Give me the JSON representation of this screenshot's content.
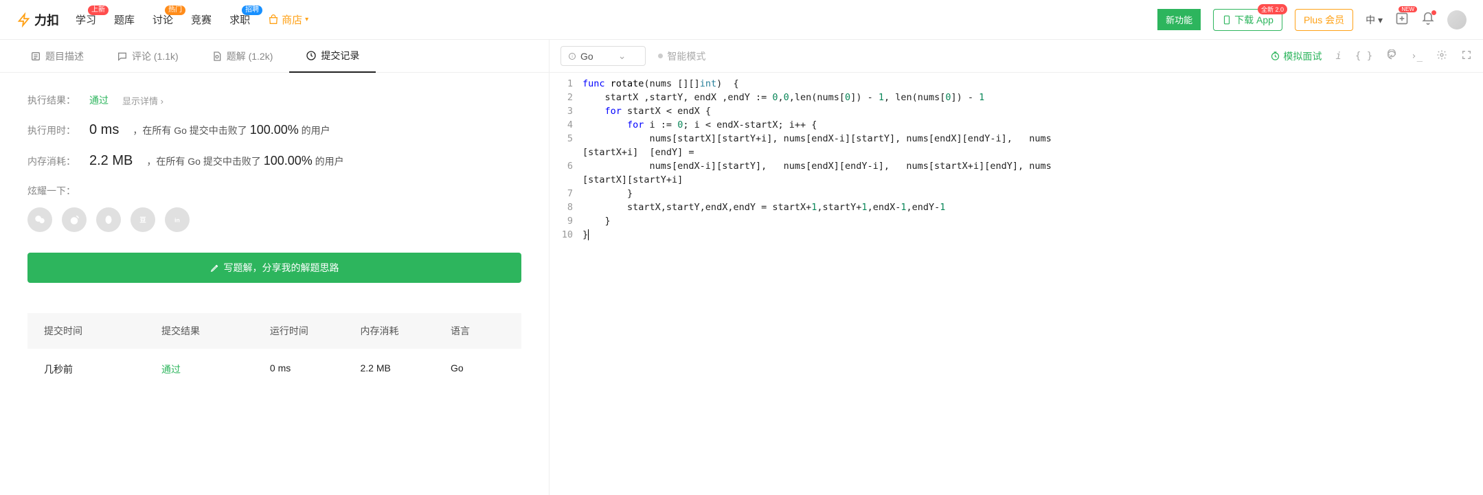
{
  "nav": {
    "logo": "力扣",
    "items": [
      {
        "label": "学习",
        "badge": "上新",
        "badgeClass": ""
      },
      {
        "label": "题库",
        "badge": "",
        "badgeClass": ""
      },
      {
        "label": "讨论",
        "badge": "热门",
        "badgeClass": "orange"
      },
      {
        "label": "竞赛",
        "badge": "",
        "badgeClass": ""
      },
      {
        "label": "求职",
        "badge": "招聘",
        "badgeClass": "blue"
      }
    ],
    "shop": "商店",
    "newFeature": "新功能",
    "download": "下载 App",
    "downloadBadge": "全新 2.0",
    "plus": "Plus 会员",
    "langSel": "中",
    "newPill": "NEW"
  },
  "tabs": [
    {
      "label": "题目描述",
      "count": ""
    },
    {
      "label": "评论",
      "count": "(1.1k)"
    },
    {
      "label": "题解",
      "count": "(1.2k)"
    },
    {
      "label": "提交记录",
      "count": ""
    }
  ],
  "activeTab": 3,
  "result": {
    "execLabel": "执行结果：",
    "status": "通过",
    "detailLink": "显示详情 ›",
    "timeLabel": "执行用时：",
    "timeVal": "0 ms",
    "timeText1": "，在所有 Go 提交中击败了",
    "timePct": "100.00%",
    "timeText2": " 的用户",
    "memLabel": "内存消耗：",
    "memVal": "2.2 MB",
    "memText1": "，在所有 Go 提交中击败了",
    "memPct": "100.00%",
    "memText2": " 的用户",
    "shareLabel": "炫耀一下：",
    "writeSoln": "写题解，分享我的解题思路"
  },
  "history": {
    "headers": {
      "time": "提交时间",
      "result": "提交结果",
      "runtime": "运行时间",
      "memory": "内存消耗",
      "lang": "语言"
    },
    "rows": [
      {
        "time": "几秒前",
        "result": "通过",
        "runtime": "0 ms",
        "memory": "2.2 MB",
        "lang": "Go"
      }
    ]
  },
  "editor": {
    "lang": "Go",
    "smartMode": "智能模式",
    "mockBtn": "模拟面试",
    "lines": [
      {
        "n": 1,
        "html": "<span class='kw'>func</span> <span class='fn'>rotate</span>(nums [][]<span class='ty'>int</span>)  {"
      },
      {
        "n": 2,
        "html": "    startX ,startY, endX ,endY := <span class='nm'>0</span>,<span class='nm'>0</span>,len(nums[<span class='nm'>0</span>]) - <span class='nm'>1</span>, len(nums[<span class='nm'>0</span>]) - <span class='nm'>1</span>"
      },
      {
        "n": 3,
        "html": "    <span class='kw'>for</span> startX &lt; endX {"
      },
      {
        "n": 4,
        "html": "        <span class='kw'>for</span> i := <span class='nm'>0</span>; i &lt; endX-startX; i++ {"
      },
      {
        "n": 5,
        "html": "            nums[startX][startY+i], nums[endX-i][startY], nums[endX][endY-i],   nums\n[startX+i]  [endY] ="
      },
      {
        "n": 6,
        "html": "            nums[endX-i][startY],   nums[endX][endY-i],   nums[startX+i][endY], nums\n[startX][startY+i]"
      },
      {
        "n": 7,
        "html": "        }"
      },
      {
        "n": 8,
        "html": "        startX,startY,endX,endY = startX+<span class='nm'>1</span>,startY+<span class='nm'>1</span>,endX-<span class='nm'>1</span>,endY-<span class='nm'>1</span>"
      },
      {
        "n": 9,
        "html": "    }"
      },
      {
        "n": 10,
        "html": "}<span class='cursor'></span>"
      }
    ]
  }
}
